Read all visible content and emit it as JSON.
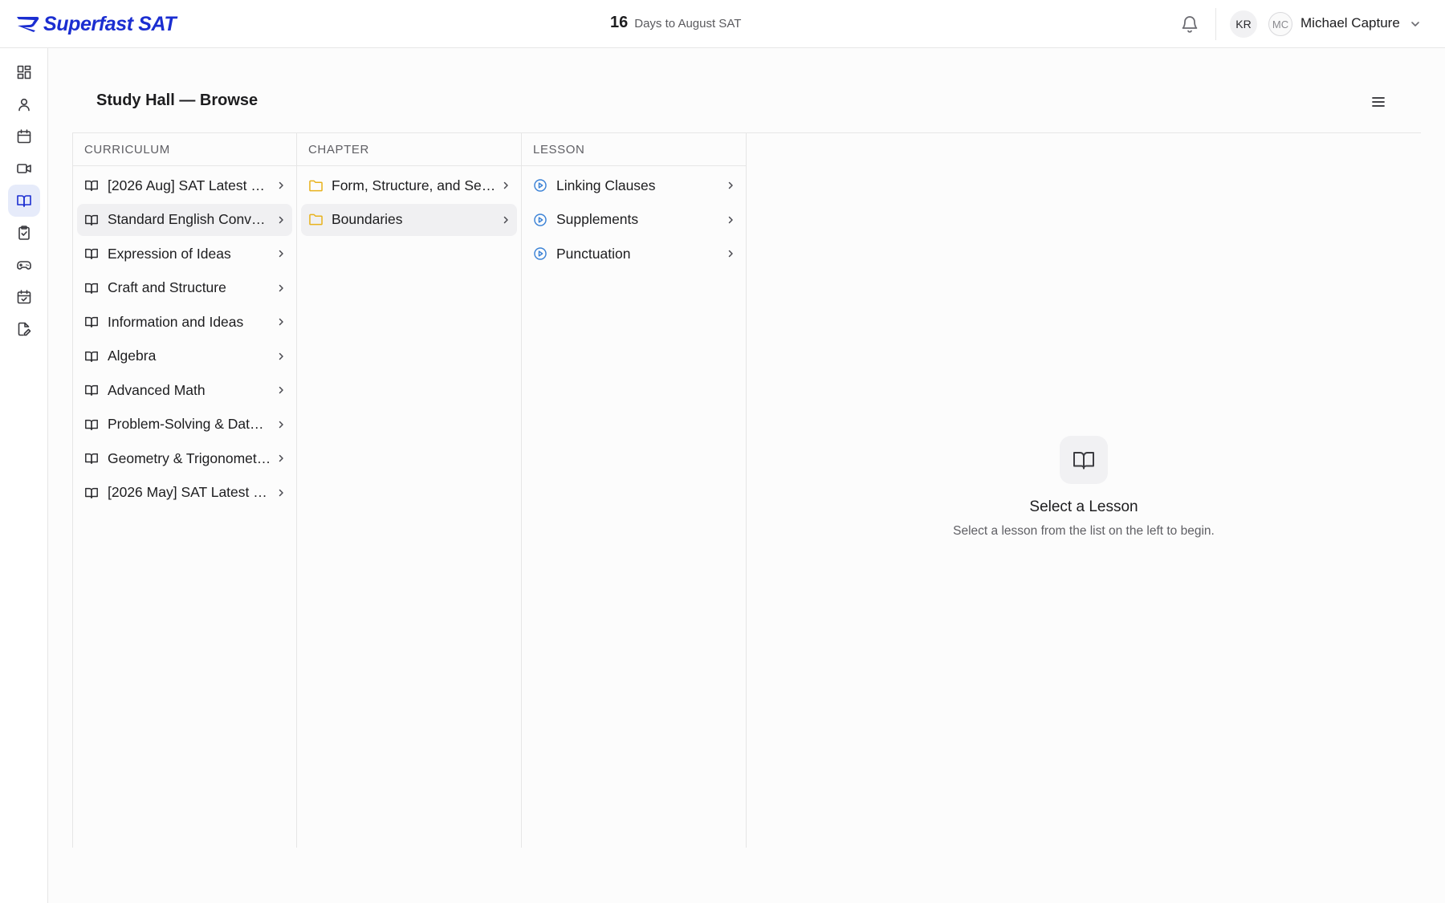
{
  "brand": {
    "name": "Superfast SAT",
    "color": "#1b2ed1"
  },
  "header": {
    "countdown_number": "16",
    "countdown_text": "Days to August SAT",
    "badge": "KR",
    "user_initials": "MC",
    "user_name": "Michael Capture"
  },
  "sidebar": {
    "items": [
      {
        "icon": "dashboard-icon",
        "active": false
      },
      {
        "icon": "user-icon",
        "active": false
      },
      {
        "icon": "calendar-icon",
        "active": false
      },
      {
        "icon": "video-icon",
        "active": false
      },
      {
        "icon": "book-open-icon",
        "active": true
      },
      {
        "icon": "clipboard-check-icon",
        "active": false
      },
      {
        "icon": "gamepad-icon",
        "active": false
      },
      {
        "icon": "calendar-check-icon",
        "active": false
      },
      {
        "icon": "file-edit-icon",
        "active": false
      }
    ]
  },
  "page": {
    "title": "Study Hall — Browse"
  },
  "columns": {
    "curriculum": {
      "header": "Curriculum",
      "items": [
        "[2026 Aug] SAT Latest …",
        "Standard English Conv…",
        "Expression of Ideas",
        "Craft and Structure",
        "Information and Ideas",
        "Algebra",
        "Advanced Math",
        "Problem-Solving & Data…",
        "Geometry & Trigonomet…",
        "[2026 May] SAT Latest …"
      ],
      "active_index": 1
    },
    "chapter": {
      "header": "Chapter",
      "items": [
        "Form, Structure, and Se…",
        "Boundaries"
      ],
      "active_index": 1
    },
    "lesson": {
      "header": "Lesson",
      "items": [
        "Linking Clauses",
        "Supplements",
        "Punctuation"
      ]
    }
  },
  "empty_state": {
    "title": "Select a Lesson",
    "subtitle": "Select a lesson from the list on the left to begin."
  },
  "colors": {
    "accent": "#1b2ed1",
    "folder": "#e8b21c",
    "lesson_icon": "#3b82d6",
    "active_row": "#f0f0f2",
    "active_nav": "#e6ebfa"
  }
}
